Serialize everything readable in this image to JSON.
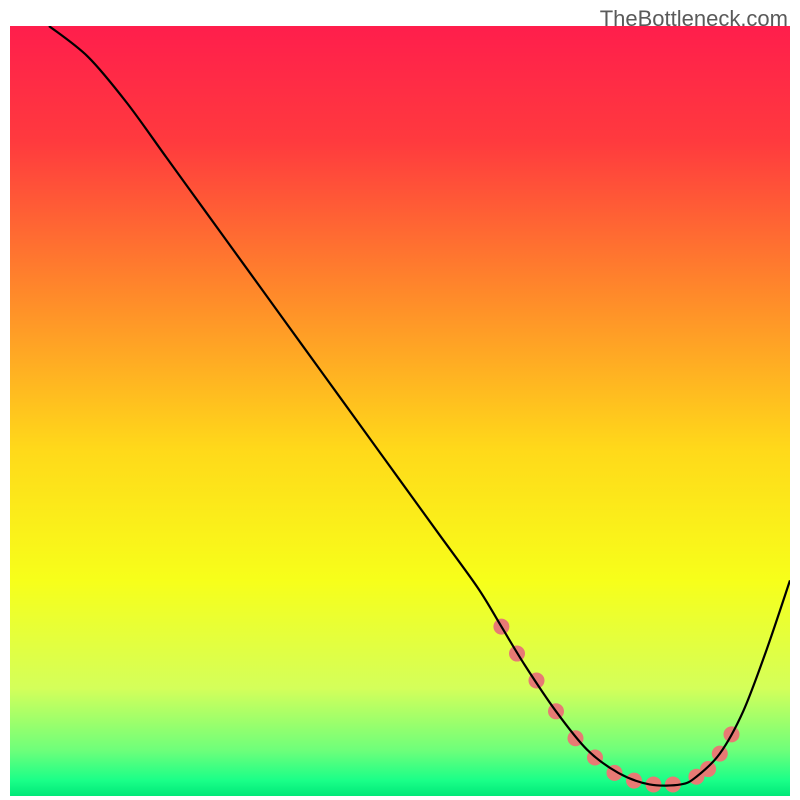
{
  "watermark": "TheBottleneck.com",
  "chart_data": {
    "type": "line",
    "title": "",
    "xlabel": "",
    "ylabel": "",
    "xlim": [
      0,
      100
    ],
    "ylim": [
      0,
      100
    ],
    "gradient_stops": [
      {
        "offset": 0.0,
        "color": "#ff1e4c"
      },
      {
        "offset": 0.15,
        "color": "#ff3a3e"
      },
      {
        "offset": 0.35,
        "color": "#ff8a2a"
      },
      {
        "offset": 0.55,
        "color": "#ffd91a"
      },
      {
        "offset": 0.72,
        "color": "#f7ff1a"
      },
      {
        "offset": 0.86,
        "color": "#d4ff5a"
      },
      {
        "offset": 0.94,
        "color": "#6fff7a"
      },
      {
        "offset": 0.98,
        "color": "#1aff88"
      },
      {
        "offset": 1.0,
        "color": "#00e878"
      }
    ],
    "series": [
      {
        "name": "curve",
        "x": [
          5,
          10,
          15,
          20,
          25,
          30,
          35,
          40,
          45,
          50,
          55,
          60,
          63,
          66,
          70,
          74,
          78,
          82,
          86,
          88,
          91,
          94,
          97,
          100
        ],
        "y": [
          100,
          96,
          90,
          83,
          76,
          69,
          62,
          55,
          48,
          41,
          34,
          27,
          22,
          17,
          11,
          6,
          3,
          1.5,
          1.5,
          2.5,
          5.5,
          11,
          19,
          28
        ]
      }
    ],
    "marker_points": {
      "x": [
        63,
        65,
        67.5,
        70,
        72.5,
        75,
        77.5,
        80,
        82.5,
        85,
        88,
        89.5,
        91,
        92.5
      ],
      "y": [
        22,
        18.5,
        15,
        11,
        7.5,
        5,
        3,
        2,
        1.5,
        1.5,
        2.5,
        3.5,
        5.5,
        8
      ]
    },
    "marker_color": "#e77a74",
    "marker_radius": 8,
    "line_color": "#000000",
    "line_width": 2.2
  }
}
